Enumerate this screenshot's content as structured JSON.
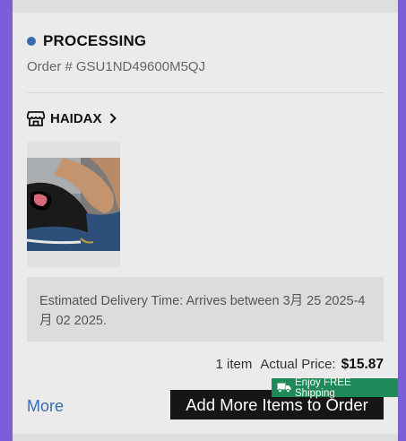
{
  "order": {
    "status": "PROCESSING",
    "order_label": "Order #",
    "order_number": "GSU1ND49600M5QJ"
  },
  "store": {
    "name": "HAIDAX",
    "icon": "store-icon"
  },
  "product": {
    "image": "black-peep-toe-wedge-sandal-photo"
  },
  "delivery": {
    "text": "Estimated Delivery Time: Arrives between 3月 25 2025-4月 02 2025."
  },
  "summary": {
    "item_count": "1 item",
    "price_label": "Actual Price:",
    "price_value": "$15.87"
  },
  "actions": {
    "more_label": "More",
    "add_more_label": "Add More Items to Order",
    "free_shipping_badge": "Enjoy FREE Shipping"
  },
  "colors": {
    "status_dot": "#3b6bb0",
    "link": "#3b6bb0",
    "badge": "#1f8a59",
    "button": "#161616",
    "side_accent": "#7b5ed8"
  }
}
